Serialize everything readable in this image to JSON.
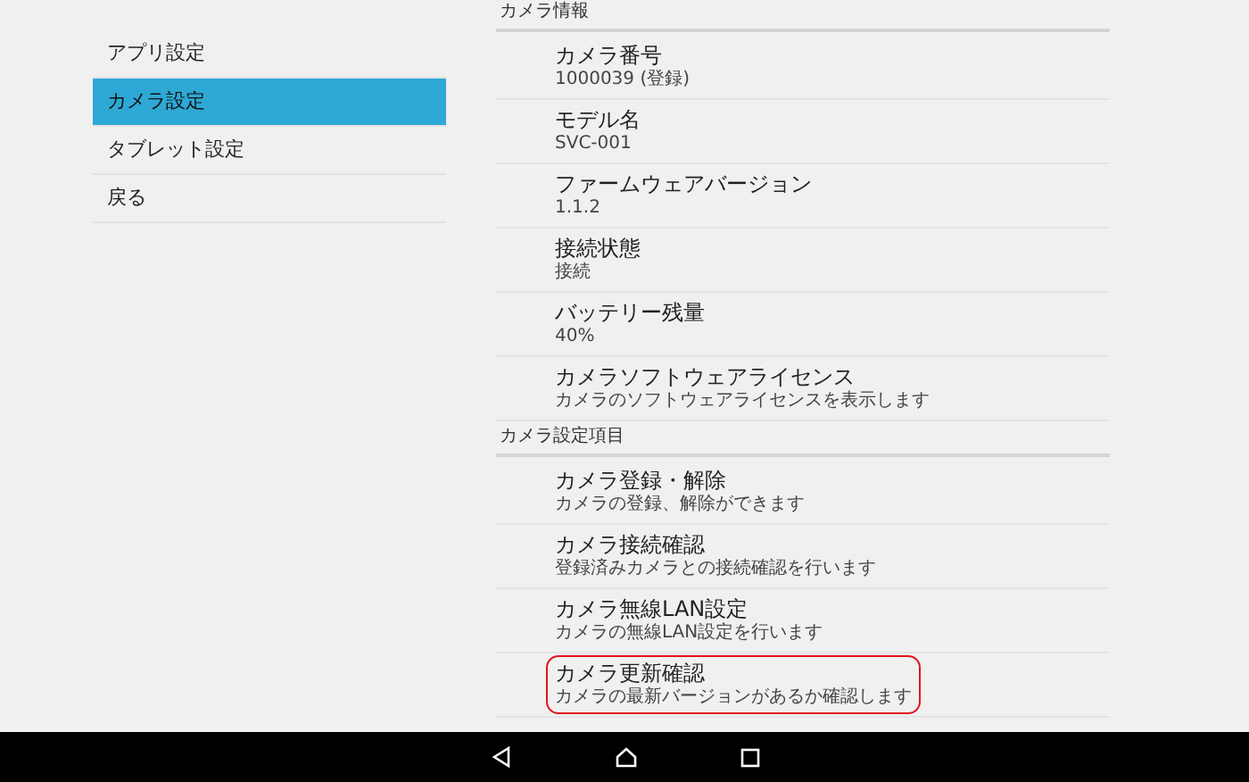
{
  "sidebar": {
    "items": [
      {
        "label": "アプリ設定",
        "selected": false
      },
      {
        "label": "カメラ設定",
        "selected": true
      },
      {
        "label": "タブレット設定",
        "selected": false
      },
      {
        "label": "戻る",
        "selected": false
      }
    ]
  },
  "sections": [
    {
      "header": "カメラ情報",
      "items": [
        {
          "title": "カメラ番号",
          "subtitle": "1000039 (登録)",
          "highlighted": false
        },
        {
          "title": "モデル名",
          "subtitle": "SVC-001",
          "highlighted": false
        },
        {
          "title": "ファームウェアバージョン",
          "subtitle": "1.1.2",
          "highlighted": false
        },
        {
          "title": "接続状態",
          "subtitle": "接続",
          "highlighted": false
        },
        {
          "title": "バッテリー残量",
          "subtitle": "40%",
          "highlighted": false
        },
        {
          "title": "カメラソフトウェアライセンス",
          "subtitle": "カメラのソフトウェアライセンスを表示します",
          "highlighted": false
        }
      ]
    },
    {
      "header": "カメラ設定項目",
      "items": [
        {
          "title": "カメラ登録・解除",
          "subtitle": "カメラの登録、解除ができます",
          "highlighted": false
        },
        {
          "title": "カメラ接続確認",
          "subtitle": "登録済みカメラとの接続確認を行います",
          "highlighted": false
        },
        {
          "title": "カメラ無線LAN設定",
          "subtitle": "カメラの無線LAN設定を行います",
          "highlighted": false
        },
        {
          "title": "カメラ更新確認",
          "subtitle": "カメラの最新バージョンがあるか確認します",
          "highlighted": true
        }
      ]
    }
  ]
}
